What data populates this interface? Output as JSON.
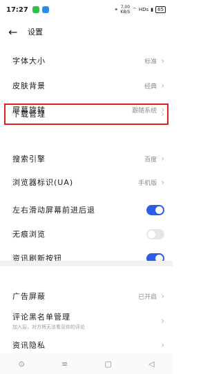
{
  "status": {
    "time": "17:27",
    "speed_value": "7.00",
    "speed_unit": "KB/S",
    "hd": "HDs",
    "battery": "65"
  },
  "header": {
    "title": "设置"
  },
  "settings": [
    {
      "label": "字体大小",
      "value": "标准"
    },
    {
      "label": "皮肤背景",
      "value": "经典"
    },
    {
      "label": "屏幕旋转",
      "value": "跟随系统"
    },
    {
      "label": "下载管理",
      "value": ""
    },
    {
      "label": "搜索引擎",
      "value": "百度"
    },
    {
      "label": "浏览器标识(UA)",
      "value": "手机版"
    }
  ],
  "toggles": [
    {
      "label": "左右滑动屏幕前进后退",
      "on": true
    },
    {
      "label": "无痕浏览",
      "on": false
    },
    {
      "label": "资讯刷新按钮",
      "on": true
    }
  ],
  "lower": [
    {
      "label": "广告屏蔽",
      "value": "已开启"
    },
    {
      "label": "评论黑名单管理",
      "sub": "加入后，对方将无法看见你的评论",
      "value": ""
    },
    {
      "label": "资讯隐私",
      "value": ""
    }
  ],
  "colors": {
    "accent": "#2d5ce6",
    "highlight": "#e01e1e"
  }
}
